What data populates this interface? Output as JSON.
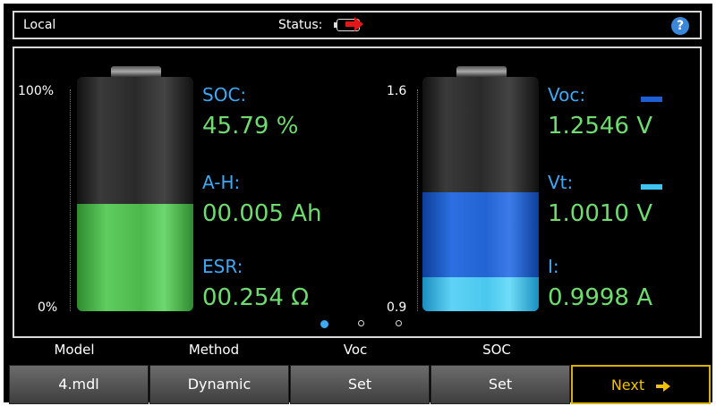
{
  "status_bar": {
    "mode": "Local",
    "status_label": "Status:",
    "help_label": "?"
  },
  "left_gauge": {
    "top_label": "100%",
    "bottom_label": "0%",
    "fill_fraction": 0.4579,
    "fill_color": "#5fcc5f",
    "readings": [
      {
        "label": "SOC:",
        "value": "45.79 %"
      },
      {
        "label": "A-H:",
        "value": "00.005 Ah"
      },
      {
        "label": "ESR:",
        "value": "00.254 Ω"
      }
    ]
  },
  "right_gauge": {
    "top_label": "1.6",
    "bottom_label": "0.9",
    "voc_fraction": 0.5066,
    "vt_fraction": 0.1443,
    "readings": [
      {
        "label": "Voc:",
        "value": "1.2546 V",
        "legend_color": "#1f5fd6"
      },
      {
        "label": "Vt:",
        "value": "1.0010 V",
        "legend_color": "#3fc3f0"
      },
      {
        "label": "I:",
        "value": "0.9998 A"
      }
    ]
  },
  "page_dots": {
    "count": 3,
    "active": 0
  },
  "soft_key_labels": [
    "Model",
    "Method",
    "Voc",
    "SOC",
    ""
  ],
  "soft_keys": [
    "4.mdl",
    "Dynamic",
    "Set",
    "Set",
    "Next"
  ],
  "colors": {
    "label_blue": "#3fa9f5",
    "value_green": "#6fdc6f",
    "next_accent": "#f0c200"
  }
}
